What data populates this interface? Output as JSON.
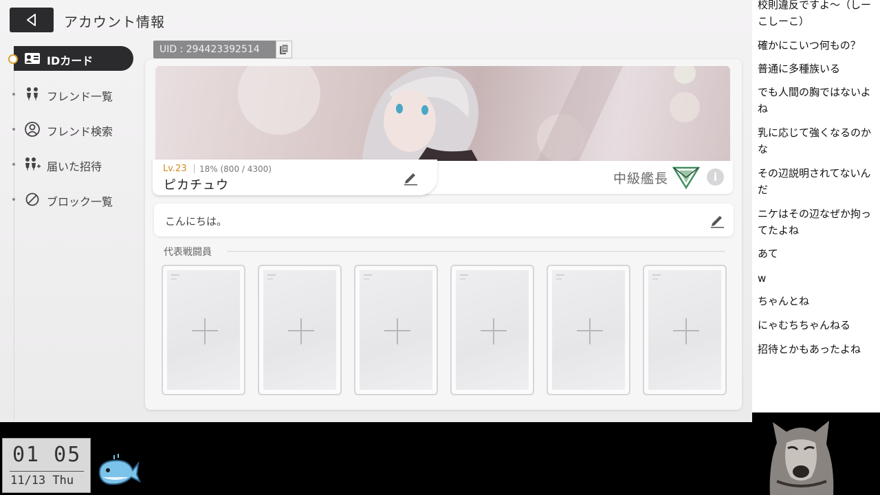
{
  "header": {
    "title": "アカウント情報",
    "back_icon": "back-arrow-icon"
  },
  "sidebar": {
    "items": [
      {
        "label": "IDカード",
        "icon": "id-card-icon",
        "active": true
      },
      {
        "label": "フレンド一覧",
        "icon": "friends-icon",
        "active": false
      },
      {
        "label": "フレンド検索",
        "icon": "friend-search-icon",
        "active": false
      },
      {
        "label": "届いた招待",
        "icon": "invite-icon",
        "active": false
      },
      {
        "label": "ブロック一覧",
        "icon": "block-icon",
        "active": false
      }
    ]
  },
  "profile": {
    "uid": "UID : 294423392514",
    "level": "Lv.23",
    "exp": "18% (800 / 4300)",
    "name": "ピカチュウ",
    "rank": "中級艦長",
    "greeting": "こんにちは。"
  },
  "representatives": {
    "title": "代表戦闘員",
    "slots": [
      "empty",
      "empty",
      "empty",
      "empty",
      "empty",
      "empty"
    ]
  },
  "chat": [
    "校則違反ですよ～（しーこしーこ）",
    "確かにこいつ何もの？",
    "普通に多種族いる",
    "でも人間の胸ではないよね",
    "乳に応じて強くなるのかな",
    "その辺説明されてないんだ",
    "ニケはその辺なぜか拘ってたよね",
    "あて",
    "w",
    "ちゃんとね",
    "にゃむちちゃんねる",
    "招待とかもあったよね"
  ],
  "clock": {
    "time": "01 05",
    "date": "11/13 Thu"
  },
  "colors": {
    "accent": "#d48a1e",
    "dark": "#2b2b2e",
    "rank_emblem": "#3f8f5f"
  }
}
